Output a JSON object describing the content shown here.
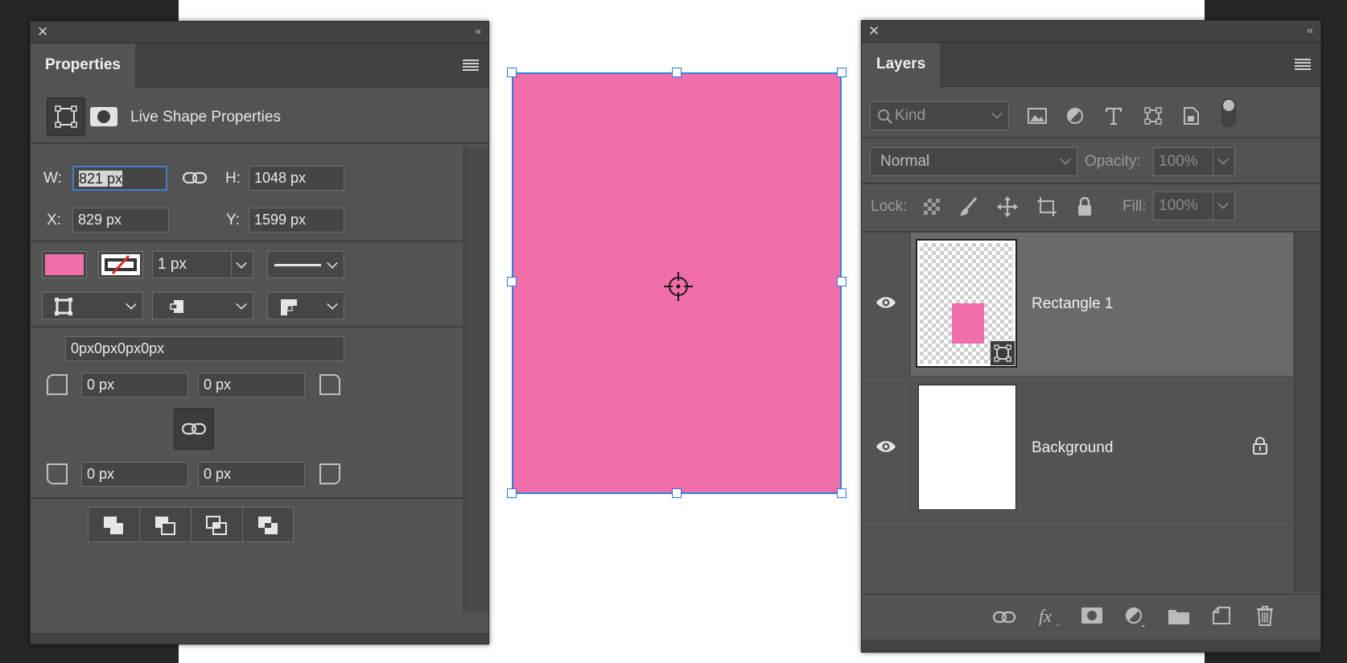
{
  "properties_panel": {
    "tab_title": "Properties",
    "section_title": "Live Shape Properties",
    "w_label": "W:",
    "w_value": "821 px",
    "h_label": "H:",
    "h_value": "1048 px",
    "x_label": "X:",
    "x_value": "829 px",
    "y_label": "Y:",
    "y_value": "1599 px",
    "fill_color": "#f06ea9",
    "stroke_width": "1 px",
    "corner_radii_summary": "0px0px0px0px",
    "corner_top_left": "0 px",
    "corner_top_right": "0 px",
    "corner_bottom_left": "0 px",
    "corner_bottom_right": "0 px"
  },
  "layers_panel": {
    "tab_title": "Layers",
    "filter_kind": "Kind",
    "blend_mode": "Normal",
    "opacity_label": "Opacity:",
    "opacity_value": "100%",
    "lock_label": "Lock:",
    "fill_label": "Fill:",
    "fill_value": "100%",
    "layers": [
      {
        "name": "Rectangle 1",
        "selected": true
      },
      {
        "name": "Background",
        "locked": true
      }
    ]
  },
  "colors": {
    "shape_pink": "#f06ea9",
    "selection_blue": "#2f82e0",
    "panel_bg": "#535353"
  }
}
